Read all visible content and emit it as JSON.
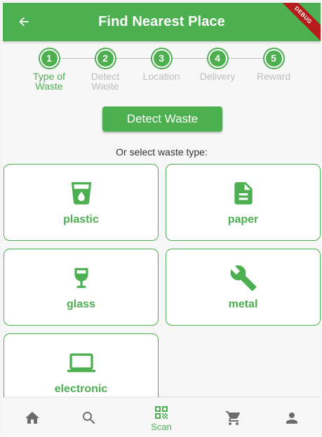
{
  "appbar": {
    "title": "Find Nearest Place",
    "debug_label": "DEBUG"
  },
  "stepper": {
    "steps": [
      {
        "number": "1",
        "label_line1": "Type of",
        "label_line2": "Waste",
        "active": true
      },
      {
        "number": "2",
        "label_line1": "Detect",
        "label_line2": "Waste",
        "active": true
      },
      {
        "number": "3",
        "label_line1": "Location",
        "label_line2": "",
        "active": true
      },
      {
        "number": "4",
        "label_line1": "Delivery",
        "label_line2": "",
        "active": true
      },
      {
        "number": "5",
        "label_line1": "Reward",
        "label_line2": "",
        "active": true
      }
    ]
  },
  "detect_button": {
    "label": "Detect Waste"
  },
  "or_select": "Or select waste type:",
  "waste_types": [
    {
      "name": "plastic",
      "icon": "cup-icon"
    },
    {
      "name": "paper",
      "icon": "document-icon"
    },
    {
      "name": "glass",
      "icon": "wine-glass-icon"
    },
    {
      "name": "metal",
      "icon": "wrench-icon"
    },
    {
      "name": "electronic",
      "icon": "laptop-icon"
    }
  ],
  "bottom_nav": {
    "items": [
      {
        "icon": "home-icon",
        "label": ""
      },
      {
        "icon": "search-icon",
        "label": ""
      },
      {
        "icon": "qr-code-icon",
        "label": "Scan"
      },
      {
        "icon": "cart-icon",
        "label": ""
      },
      {
        "icon": "person-icon",
        "label": ""
      }
    ]
  },
  "colors": {
    "primary": "#4caf50",
    "inactive": "#bdbdbd",
    "nav_icon": "#6d6d6d",
    "debug": "#b71c1c"
  }
}
